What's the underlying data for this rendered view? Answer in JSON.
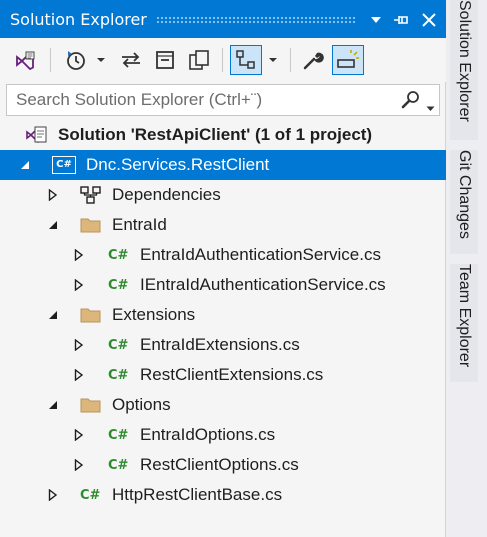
{
  "panel": {
    "title": "Solution Explorer",
    "title_buttons": [
      "dropdown-icon",
      "pin-icon",
      "close-icon"
    ]
  },
  "toolbar": {
    "items": [
      "vs-home-icon",
      "history-icon",
      "dropdown-icon",
      "sync-arrows-icon",
      "collapse-all-icon",
      "show-all-files-icon",
      "view-hierarchy-icon",
      "dropdown-icon",
      "properties-wrench-icon",
      "preview-selected-icon"
    ]
  },
  "search": {
    "placeholder": "Search Solution Explorer (Ctrl+¨)"
  },
  "tree": {
    "solution": "Solution 'RestApiClient' (1 of 1 project)",
    "project": "Dnc.Services.RestClient",
    "dependencies": "Dependencies",
    "folder_entraid": "EntraId",
    "file_1": "EntraIdAuthenticationService.cs",
    "file_2": "IEntraIdAuthenticationService.cs",
    "folder_extensions": "Extensions",
    "file_3": "EntraIdExtensions.cs",
    "file_4": "RestClientExtensions.cs",
    "folder_options": "Options",
    "file_5": "EntraIdOptions.cs",
    "file_6": "RestClientOptions.cs",
    "file_7": "HttpRestClientBase.cs",
    "csharp_badge": "C#",
    "project_badge": "C#"
  },
  "side_tabs": [
    "Solution Explorer",
    "Git Changes",
    "Team Explorer"
  ],
  "colors": {
    "accent": "#0078d4",
    "csharp_green": "#2e8b2e",
    "folder": "#dcb67a",
    "solution_purple": "#68217a"
  }
}
